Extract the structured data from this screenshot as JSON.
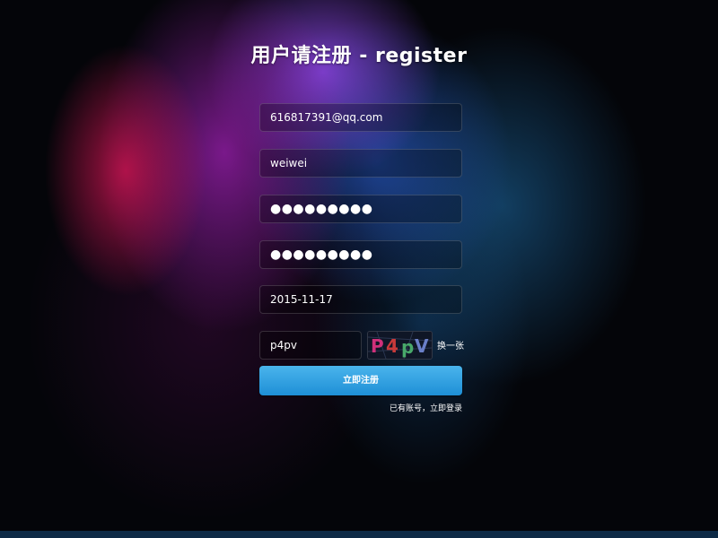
{
  "title": "用户请注册 - register",
  "form": {
    "email": "616817391@qq.com",
    "username": "weiwei",
    "password": "●●●●●●●●●",
    "confirm_password": "●●●●●●●●●",
    "date": "2015-11-17",
    "captcha_input": "p4pv",
    "captcha_image_text": "P4pV",
    "refresh_label": "换一张",
    "submit_label": "立即注册",
    "login_link": "已有账号，立即登录"
  },
  "colors": {
    "button_top": "#4ab4ec",
    "button_bottom": "#1e8fd6",
    "background": "#040509",
    "bottom_bar": "#0d2a46"
  }
}
